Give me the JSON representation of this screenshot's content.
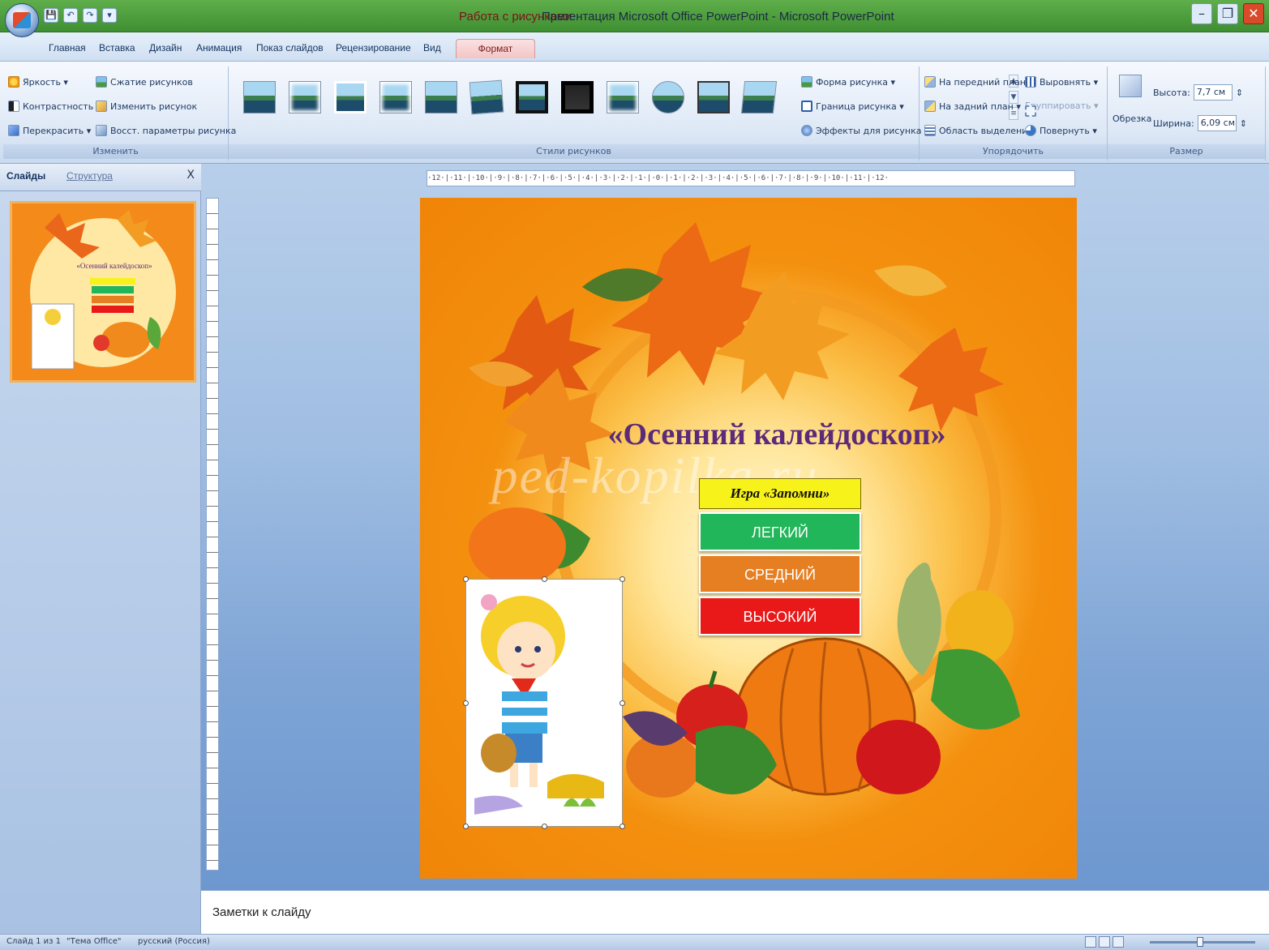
{
  "titlebar": {
    "context": "Работа с рисунками",
    "title": "Презентация Microsoft Office PowerPoint - Microsoft PowerPoint",
    "min": "–",
    "max": "❐",
    "close": "✕"
  },
  "qat": {
    "save": "💾",
    "undo": "↶",
    "redo": "↷",
    "more": "▾"
  },
  "tabs": {
    "home": "Главная",
    "insert": "Вставка",
    "design": "Дизайн",
    "animation": "Анимация",
    "slideshow": "Показ слайдов",
    "review": "Рецензирование",
    "view": "Вид",
    "format": "Формат"
  },
  "ribbon": {
    "adjust": {
      "label": "Изменить",
      "brightness": "Яркость ▾",
      "contrast": "Контрастность ▾",
      "recolor": "Перекрасить ▾",
      "compress": "Сжатие рисунков",
      "change": "Изменить рисунок",
      "reset": "Восст. параметры рисунка"
    },
    "styles": {
      "label": "Стили рисунков",
      "shape": "Форма рисунка ▾",
      "border": "Граница рисунка ▾",
      "effects": "Эффекты для рисунка ▾"
    },
    "arrange": {
      "label": "Упорядочить",
      "front": "На передний план ▾",
      "back": "На задний план ▾",
      "selection": "Область выделения",
      "align": "Выровнять ▾",
      "group": "Группировать ▾",
      "rotate": "Повернуть ▾"
    },
    "size": {
      "label": "Размер",
      "crop": "Обрезка",
      "height_label": "Высота:",
      "height": "7,7 см",
      "width_label": "Ширина:",
      "width": "6,09 см"
    }
  },
  "left_panel": {
    "tab_slides": "Слайды",
    "tab_outline": "Структура",
    "close": "X"
  },
  "ruler": {
    "text": "·12·|·11·|·10·|·9·|·8·|·7·|·6·|·5·|·4·|·3·|·2·|·1·|·0·|·1·|·2·|·3·|·4·|·5·|·6·|·7·|·8·|·9·|·10·|·11·|·12·"
  },
  "slide": {
    "title": "«Осенний калейдоскоп»",
    "watermark": "ped-kopilka.ru",
    "menu_title": "Игра «Запомни»",
    "levels": {
      "easy": "ЛЕГКИЙ",
      "medium": "СРЕДНИЙ",
      "hard": "ВЫСОКИЙ"
    }
  },
  "notes": {
    "placeholder": "Заметки к слайду"
  },
  "status": {
    "slide": "Слайд 1 из 1",
    "theme": "\"Тема Office\"",
    "language": "русский (Россия)"
  },
  "colors": {
    "titlebar": "#4f9e40",
    "slide_bg": "#f48a1a",
    "menu_yellow": "#f7f21a",
    "easy": "#22b65a",
    "medium": "#e67e22",
    "hard": "#ea1919",
    "title_text": "#5b2a7a"
  }
}
